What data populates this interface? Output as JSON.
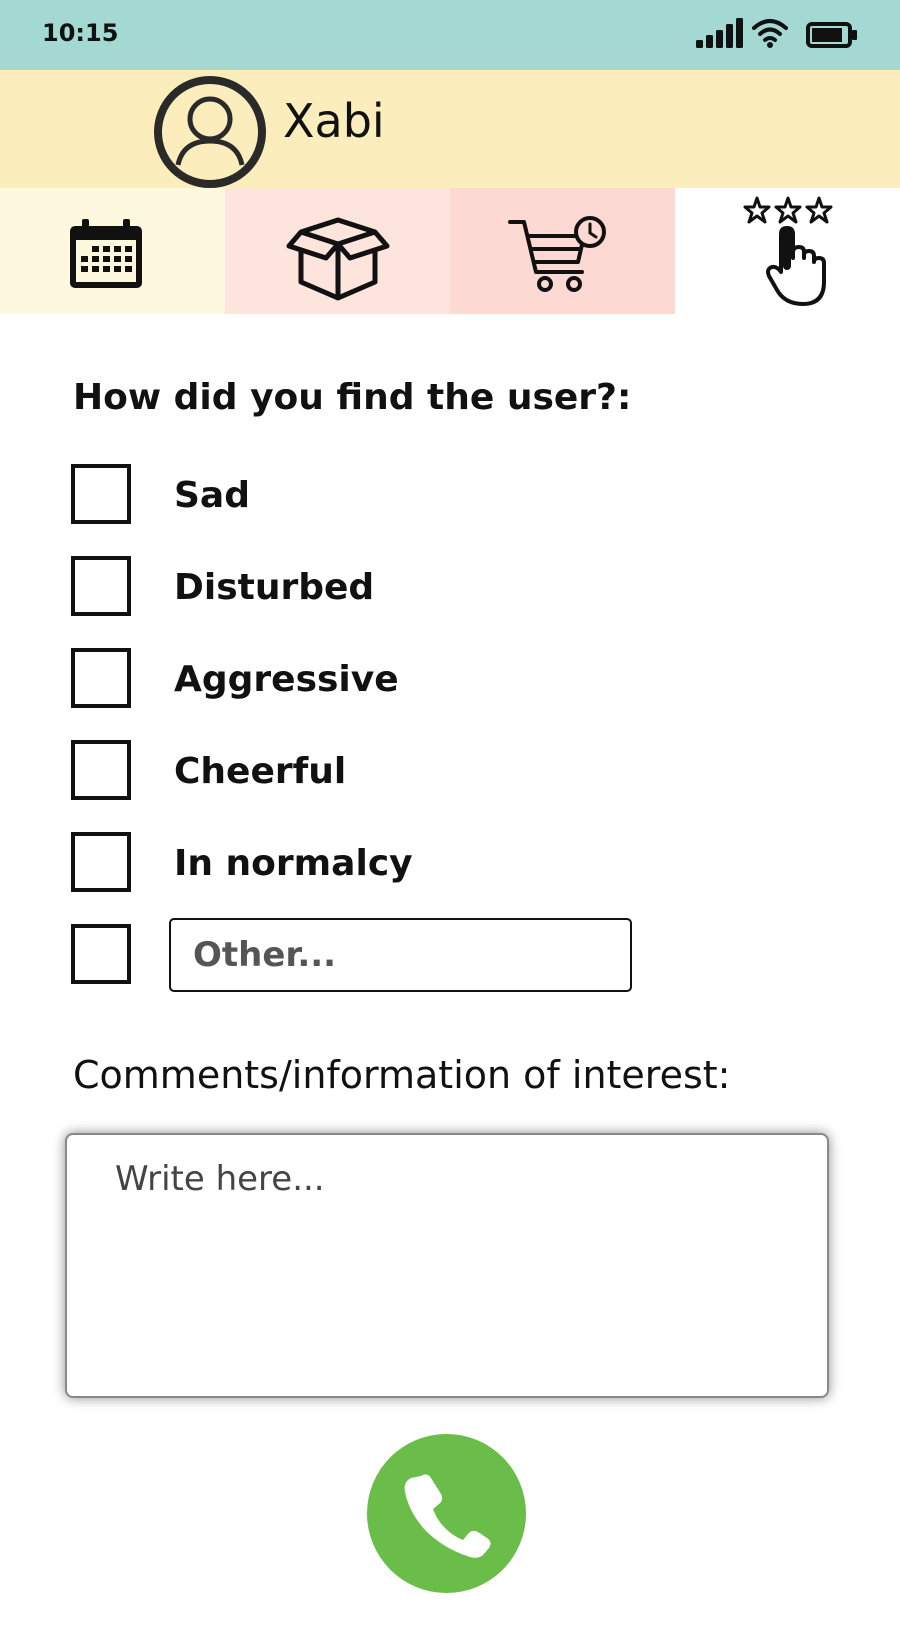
{
  "status_bar": {
    "time": "10:15",
    "icons": [
      "signal-icon",
      "wifi-icon",
      "battery-icon"
    ]
  },
  "header": {
    "avatar_icon": "user-circle-icon",
    "username": "Xabi",
    "background": "#fbeebc"
  },
  "tabs": [
    {
      "icon": "calendar-icon",
      "background": "#fdf8de"
    },
    {
      "icon": "box-icon",
      "background": "#fde4dc"
    },
    {
      "icon": "cart-clock-icon",
      "background": "#fcd9d3"
    },
    {
      "icon": "rating-stars-hand-icon",
      "background": "#ffffff",
      "selected": true
    }
  ],
  "form": {
    "question": "How did you find the user?:",
    "options": [
      {
        "label": "Sad",
        "checked": false
      },
      {
        "label": "Disturbed",
        "checked": false
      },
      {
        "label": "Aggressive",
        "checked": false
      },
      {
        "label": "Cheerful",
        "checked": false
      },
      {
        "label": "In normalcy",
        "checked": false
      }
    ],
    "other": {
      "checked": false,
      "placeholder": "Other..."
    },
    "comments_label": "Comments/information of interest:",
    "comments_placeholder": "Write here..."
  },
  "call_button": {
    "icon": "phone-icon",
    "color": "#69bd48"
  },
  "colors": {
    "status_bar": "#a4d8d2"
  }
}
